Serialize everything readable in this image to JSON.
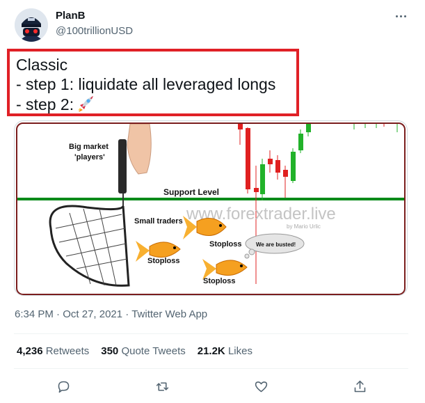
{
  "author": {
    "display_name": "PlanB",
    "handle": "@100trillionUSD",
    "avatar_icon": "avatar-planb-icon"
  },
  "tweet": {
    "lines": [
      "Classic",
      "- step 1: liquidate all leveraged longs",
      "- step 2:"
    ],
    "emoji": "rocket-icon",
    "highlight_color": "#e02026"
  },
  "media": {
    "labels": {
      "big_players": [
        "Big market",
        "'players'"
      ],
      "support": "Support Level",
      "small_traders": "Small traders",
      "stoploss": "Stoploss",
      "busted": "We are busted!",
      "watermark": "www.forextrader.live",
      "credit": "by Mario Urlic"
    }
  },
  "meta": {
    "time": "6:34 PM",
    "date": "Oct 27, 2021",
    "source": "Twitter Web App",
    "separator": " · "
  },
  "stats": {
    "retweets_count": "4,236",
    "retweets_label": "Retweets",
    "quotes_count": "350",
    "quotes_label": "Quote Tweets",
    "likes_count": "21.2K",
    "likes_label": "Likes"
  },
  "actions": [
    "reply-icon",
    "retweet-icon",
    "like-icon",
    "share-icon"
  ]
}
